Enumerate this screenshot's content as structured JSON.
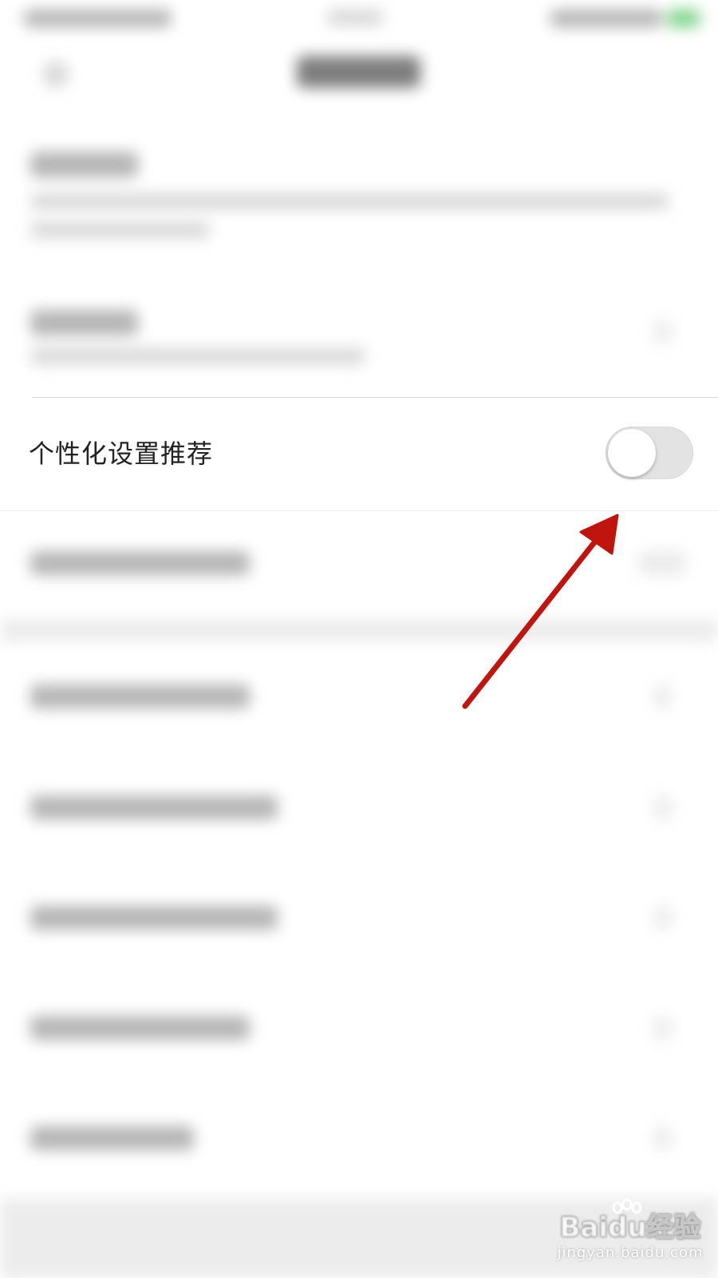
{
  "setting": {
    "label": "个性化设置推荐",
    "toggle_state": "off"
  },
  "watermark": {
    "brand": "Baidu经验",
    "url": "jingyan.baidu.com"
  },
  "colors": {
    "arrow": "#c0150e",
    "toggle_track_off": "#e3e3e3",
    "label_text": "#222222"
  }
}
